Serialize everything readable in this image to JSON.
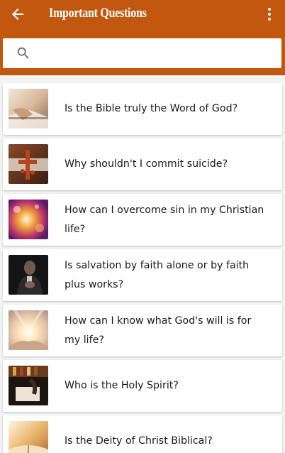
{
  "appbar": {
    "title": "Important Questions",
    "background_color": "#c2580f",
    "back_icon": "arrow-left-icon",
    "menu_icon": "more-vert-icon"
  },
  "search": {
    "placeholder": "",
    "value": "",
    "icon": "search-icon"
  },
  "questions": [
    {
      "text": "Is the Bible truly the Word of God?",
      "thumbnail": "open-bible-hands-photo"
    },
    {
      "text": "Why shouldn't I commit suicide?",
      "thumbnail": "cross-on-bible-photo"
    },
    {
      "text": "How can I overcome sin in my Christian life?",
      "thumbnail": "light-bokeh-photo"
    },
    {
      "text": "Is salvation by faith alone or by faith plus works?",
      "thumbnail": "man-praying-photo"
    },
    {
      "text": "How can I know what God's will is for my life?",
      "thumbnail": "light-rays-photo"
    },
    {
      "text": "Who is the Holy Spirit?",
      "thumbnail": "person-writing-photo"
    },
    {
      "text": "Is the Deity of Christ Biblical?",
      "thumbnail": "bible-pages-photo"
    }
  ]
}
